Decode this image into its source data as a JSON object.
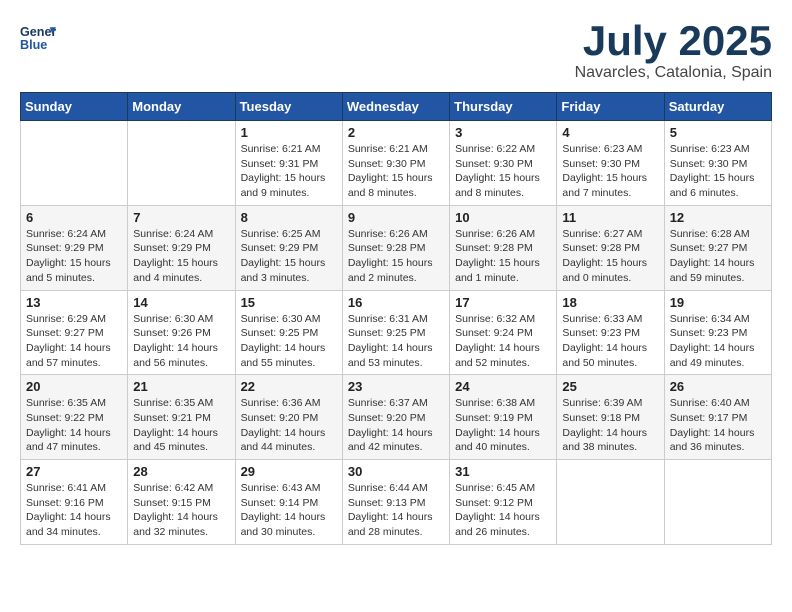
{
  "header": {
    "logo_line1": "General",
    "logo_line2": "Blue",
    "month": "July 2025",
    "location": "Navarcles, Catalonia, Spain"
  },
  "weekdays": [
    "Sunday",
    "Monday",
    "Tuesday",
    "Wednesday",
    "Thursday",
    "Friday",
    "Saturday"
  ],
  "weeks": [
    [
      {
        "day": "",
        "info": ""
      },
      {
        "day": "",
        "info": ""
      },
      {
        "day": "1",
        "info": "Sunrise: 6:21 AM\nSunset: 9:31 PM\nDaylight: 15 hours\nand 9 minutes."
      },
      {
        "day": "2",
        "info": "Sunrise: 6:21 AM\nSunset: 9:30 PM\nDaylight: 15 hours\nand 8 minutes."
      },
      {
        "day": "3",
        "info": "Sunrise: 6:22 AM\nSunset: 9:30 PM\nDaylight: 15 hours\nand 8 minutes."
      },
      {
        "day": "4",
        "info": "Sunrise: 6:23 AM\nSunset: 9:30 PM\nDaylight: 15 hours\nand 7 minutes."
      },
      {
        "day": "5",
        "info": "Sunrise: 6:23 AM\nSunset: 9:30 PM\nDaylight: 15 hours\nand 6 minutes."
      }
    ],
    [
      {
        "day": "6",
        "info": "Sunrise: 6:24 AM\nSunset: 9:29 PM\nDaylight: 15 hours\nand 5 minutes."
      },
      {
        "day": "7",
        "info": "Sunrise: 6:24 AM\nSunset: 9:29 PM\nDaylight: 15 hours\nand 4 minutes."
      },
      {
        "day": "8",
        "info": "Sunrise: 6:25 AM\nSunset: 9:29 PM\nDaylight: 15 hours\nand 3 minutes."
      },
      {
        "day": "9",
        "info": "Sunrise: 6:26 AM\nSunset: 9:28 PM\nDaylight: 15 hours\nand 2 minutes."
      },
      {
        "day": "10",
        "info": "Sunrise: 6:26 AM\nSunset: 9:28 PM\nDaylight: 15 hours\nand 1 minute."
      },
      {
        "day": "11",
        "info": "Sunrise: 6:27 AM\nSunset: 9:28 PM\nDaylight: 15 hours\nand 0 minutes."
      },
      {
        "day": "12",
        "info": "Sunrise: 6:28 AM\nSunset: 9:27 PM\nDaylight: 14 hours\nand 59 minutes."
      }
    ],
    [
      {
        "day": "13",
        "info": "Sunrise: 6:29 AM\nSunset: 9:27 PM\nDaylight: 14 hours\nand 57 minutes."
      },
      {
        "day": "14",
        "info": "Sunrise: 6:30 AM\nSunset: 9:26 PM\nDaylight: 14 hours\nand 56 minutes."
      },
      {
        "day": "15",
        "info": "Sunrise: 6:30 AM\nSunset: 9:25 PM\nDaylight: 14 hours\nand 55 minutes."
      },
      {
        "day": "16",
        "info": "Sunrise: 6:31 AM\nSunset: 9:25 PM\nDaylight: 14 hours\nand 53 minutes."
      },
      {
        "day": "17",
        "info": "Sunrise: 6:32 AM\nSunset: 9:24 PM\nDaylight: 14 hours\nand 52 minutes."
      },
      {
        "day": "18",
        "info": "Sunrise: 6:33 AM\nSunset: 9:23 PM\nDaylight: 14 hours\nand 50 minutes."
      },
      {
        "day": "19",
        "info": "Sunrise: 6:34 AM\nSunset: 9:23 PM\nDaylight: 14 hours\nand 49 minutes."
      }
    ],
    [
      {
        "day": "20",
        "info": "Sunrise: 6:35 AM\nSunset: 9:22 PM\nDaylight: 14 hours\nand 47 minutes."
      },
      {
        "day": "21",
        "info": "Sunrise: 6:35 AM\nSunset: 9:21 PM\nDaylight: 14 hours\nand 45 minutes."
      },
      {
        "day": "22",
        "info": "Sunrise: 6:36 AM\nSunset: 9:20 PM\nDaylight: 14 hours\nand 44 minutes."
      },
      {
        "day": "23",
        "info": "Sunrise: 6:37 AM\nSunset: 9:20 PM\nDaylight: 14 hours\nand 42 minutes."
      },
      {
        "day": "24",
        "info": "Sunrise: 6:38 AM\nSunset: 9:19 PM\nDaylight: 14 hours\nand 40 minutes."
      },
      {
        "day": "25",
        "info": "Sunrise: 6:39 AM\nSunset: 9:18 PM\nDaylight: 14 hours\nand 38 minutes."
      },
      {
        "day": "26",
        "info": "Sunrise: 6:40 AM\nSunset: 9:17 PM\nDaylight: 14 hours\nand 36 minutes."
      }
    ],
    [
      {
        "day": "27",
        "info": "Sunrise: 6:41 AM\nSunset: 9:16 PM\nDaylight: 14 hours\nand 34 minutes."
      },
      {
        "day": "28",
        "info": "Sunrise: 6:42 AM\nSunset: 9:15 PM\nDaylight: 14 hours\nand 32 minutes."
      },
      {
        "day": "29",
        "info": "Sunrise: 6:43 AM\nSunset: 9:14 PM\nDaylight: 14 hours\nand 30 minutes."
      },
      {
        "day": "30",
        "info": "Sunrise: 6:44 AM\nSunset: 9:13 PM\nDaylight: 14 hours\nand 28 minutes."
      },
      {
        "day": "31",
        "info": "Sunrise: 6:45 AM\nSunset: 9:12 PM\nDaylight: 14 hours\nand 26 minutes."
      },
      {
        "day": "",
        "info": ""
      },
      {
        "day": "",
        "info": ""
      }
    ]
  ]
}
